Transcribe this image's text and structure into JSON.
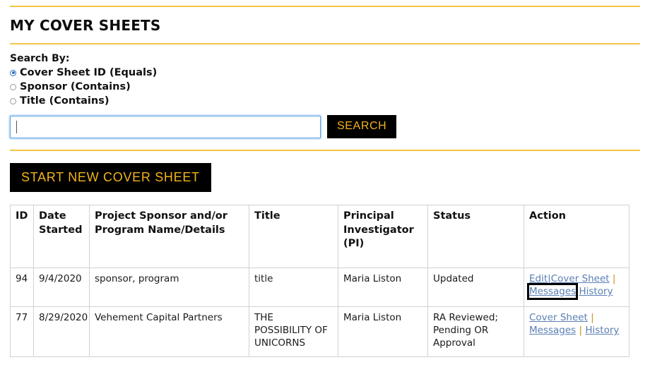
{
  "page_title": "MY COVER SHEETS",
  "search": {
    "label": "Search By:",
    "options": [
      {
        "label": "Cover Sheet ID (Equals)",
        "selected": true
      },
      {
        "label": "Sponsor (Contains)",
        "selected": false
      },
      {
        "label": "Title (Contains)",
        "selected": false
      }
    ],
    "input_value": "",
    "input_placeholder": "",
    "button_label": "SEARCH"
  },
  "start_new_button_label": "START NEW COVER SHEET",
  "table": {
    "headers": {
      "id": "ID",
      "date_started": "Date Started",
      "sponsor": "Project Sponsor and/or Program Name/Details",
      "title": "Title",
      "pi": "Principal Investigator (PI)",
      "status": "Status",
      "action": "Action"
    },
    "rows": [
      {
        "id": "94",
        "date_started": "9/4/2020",
        "sponsor": "sponsor, program",
        "title": "title",
        "pi": "Maria Liston",
        "status": "Updated",
        "actions": {
          "edit": "Edit",
          "sep1": "|",
          "cover_sheet": "Cover Sheet",
          "sep2": "|",
          "messages": "Messages",
          "history": "History"
        }
      },
      {
        "id": "77",
        "date_started": "8/29/2020",
        "sponsor": "Vehement Capital Partners",
        "title": "THE POSSIBILITY OF UNICORNS",
        "pi": "Maria Liston",
        "status": "RA Reviewed; Pending OR Approval",
        "actions": {
          "cover_sheet": "Cover Sheet",
          "sep1": "|",
          "messages": "Messages",
          "sep2": "|",
          "history": "History"
        }
      }
    ]
  },
  "colors": {
    "accent_gold": "#f5c443",
    "button_bg": "#000000",
    "button_text": "#f2b418",
    "link": "#5a7fb5",
    "focus_outline": "#000000",
    "input_border": "#59a0e0"
  }
}
